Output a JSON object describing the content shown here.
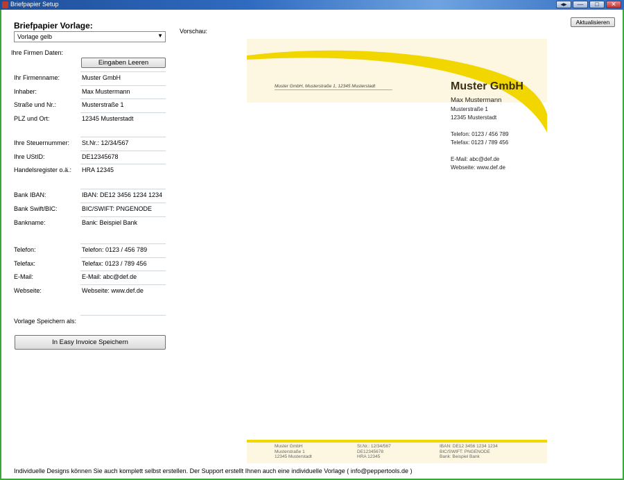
{
  "window": {
    "title": "Briefpapier Setup",
    "buttons": [
      "◂▸",
      "—",
      "□",
      "✕"
    ]
  },
  "sidebar": {
    "heading": "Briefpapier Vorlage:",
    "template_select": "Vorlage gelb",
    "company_section_label": "Ihre Firmen Daten:",
    "clear_button": "Eingaben Leeren",
    "fields": [
      {
        "label": "Ihr Firmenname:",
        "value": "Muster GmbH"
      },
      {
        "label": "Inhaber:",
        "value": "Max Mustermann"
      },
      {
        "label": "Straße und Nr.:",
        "value": "Musterstraße 1"
      },
      {
        "label": "PLZ und Ort:",
        "value": "12345 Musterstadt"
      },
      {
        "label": "Ihre Steuernummer:",
        "value": "St.Nr.: 12/34/567"
      },
      {
        "label": "Ihre UStID:",
        "value": "DE12345678"
      },
      {
        "label": "Handelsregister o.ä.:",
        "value": "HRA 12345"
      },
      {
        "label": "Bank IBAN:",
        "value": "IBAN: DE12 3456 1234 1234"
      },
      {
        "label": "Bank Swift/BIC:",
        "value": "BIC/SWIFT: PNGENODE"
      },
      {
        "label": "Bankname:",
        "value": "Bank: Beispiel Bank"
      },
      {
        "label": "Telefon:",
        "value": "Telefon: 0123 / 456 789"
      },
      {
        "label": "Telefax:",
        "value": "Telefax: 0123 / 789 456"
      },
      {
        "label": "E-Mail:",
        "value": "E-Mail: abc@def.de"
      },
      {
        "label": "Webseite:",
        "value": "Webseite: www.def.de"
      },
      {
        "label": "Vorlage Speichern als:",
        "value": ""
      }
    ],
    "save_button": "In Easy Invoice Speichern"
  },
  "preview": {
    "label": "Vorschau:",
    "refresh_button": "Aktualisieren",
    "sender_line": "Muster GmbH, Musterstraße 1, 12345 Musterstadt",
    "company": "Muster GmbH",
    "owner": "Max Mustermann",
    "street": "Musterstraße 1",
    "city": "12345 Musterstadt",
    "phone": "Telefon: 0123 / 456 789",
    "fax": "Telefax: 0123 / 789 456",
    "email": "E-Mail: abc@def.de",
    "web": "Webseite: www.def.de",
    "footer": [
      [
        "Muster GmbH",
        "Musterstraße 1",
        "12345 Musterstadt"
      ],
      [
        "St.Nr.: 12/34/567",
        "DE12345678",
        "HRA 12345"
      ],
      [
        "IBAN: DE12 3456 1234 1234",
        "BIC/SWIFT: PNGENODE",
        "Bank: Beispiel Bank"
      ]
    ],
    "accent_color": "#f2d600"
  },
  "footer_note": "Individuelle Designs können Sie auch komplett selbst erstellen. Der Support erstellt Ihnen auch eine individuelle Vorlage ( info@peppertools.de )"
}
